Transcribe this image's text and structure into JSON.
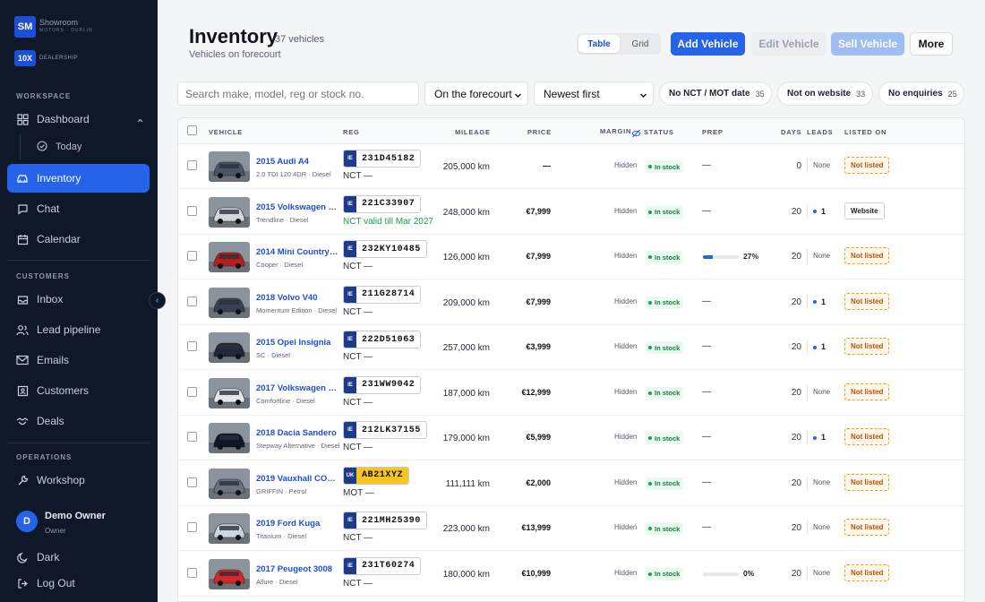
{
  "sidebar": {
    "brand_short": "SM",
    "brand_name": "Showroom",
    "brand_sub": "MOTORS · DUBLIN",
    "dealership_badge": "10X",
    "dealership_label": "DEALERSHIP",
    "workspace_title": "WORKSPACE",
    "customers_title": "CUSTOMERS",
    "operations_title": "OPERATIONS",
    "items": {
      "dashboard": "Dashboard",
      "today": "Today",
      "inventory": "Inventory",
      "chat": "Chat",
      "calendar": "Calendar",
      "inbox": "Inbox",
      "lead_pipeline": "Lead pipeline",
      "emails": "Emails",
      "customers": "Customers",
      "deals": "Deals",
      "workshop": "Workshop",
      "dark": "Dark",
      "logout": "Log Out"
    },
    "user": {
      "initial": "D",
      "name": "Demo Owner",
      "role": "Owner"
    }
  },
  "header": {
    "title": "Inventory",
    "count": "37 vehicles",
    "subtitle": "Vehicles on forecourt",
    "view_toggle": {
      "table": "Table",
      "grid": "Grid"
    },
    "add": "Add Vehicle",
    "edit": "Edit Vehicle",
    "sell": "Sell Vehicle",
    "more": "More"
  },
  "filters": {
    "search_placeholder": "Search make, model, reg or stock no.",
    "location": "On the forecourt",
    "sort": "Newest first",
    "chips": [
      {
        "label": "No NCT / MOT date",
        "count": "35"
      },
      {
        "label": "Not on website",
        "count": "33"
      },
      {
        "label": "No enquiries",
        "count": "25"
      }
    ]
  },
  "table": {
    "columns": {
      "vehicle": "VEHICLE",
      "reg": "REG",
      "mileage": "MILEAGE",
      "price": "PRICE",
      "margin": "MARGIN",
      "status": "STATUS",
      "prep": "PREP",
      "days": "DAYS",
      "leads": "LEADS",
      "listed_on": "LISTED ON"
    },
    "rows": [
      {
        "name": "2015 Audi A4",
        "sub": "2.0 TDI 120 4DR · Diesel",
        "cc": "IE",
        "reg": "231D45182",
        "nct": "NCT —",
        "mileage": "205,000 km",
        "price": "—",
        "margin": "Hidden",
        "status": "In stock",
        "prep": "—",
        "days": "0",
        "leads": "None",
        "listed": "Not listed",
        "color": "#4b5563"
      },
      {
        "name": "2015 Volkswagen Golf",
        "sub": "Trendline · Diesel",
        "cc": "IE",
        "reg": "221C33907",
        "nct": "NCT valid till Mar 2027",
        "mileage": "248,000 km",
        "price": "€7,999",
        "margin": "Hidden",
        "status": "In stock",
        "prep": "—",
        "days": "20",
        "leads": "1",
        "listed": "Website",
        "color": "#d1d5db"
      },
      {
        "name": "2014 Mini Countryman",
        "sub": "Cooper · Diesel",
        "cc": "IE",
        "reg": "232KY10485",
        "nct": "NCT —",
        "mileage": "126,000 km",
        "price": "€7,999",
        "margin": "Hidden",
        "status": "In stock",
        "prep": "27%",
        "prep_value": 27,
        "days": "20",
        "leads": "None",
        "listed": "Not listed",
        "color": "#b91c1c"
      },
      {
        "name": "2018 Volvo V40",
        "sub": "Momentum Edition · Diesel",
        "cc": "IE",
        "reg": "211G28714",
        "nct": "NCT —",
        "mileage": "209,000 km",
        "price": "€7,999",
        "margin": "Hidden",
        "status": "In stock",
        "prep": "—",
        "days": "20",
        "leads": "1",
        "listed": "Not listed",
        "color": "#374151"
      },
      {
        "name": "2015 Opel Insignia",
        "sub": "SC · Diesel",
        "cc": "IE",
        "reg": "222D51063",
        "nct": "NCT —",
        "mileage": "257,000 km",
        "price": "€3,999",
        "margin": "Hidden",
        "status": "In stock",
        "prep": "—",
        "days": "20",
        "leads": "1",
        "listed": "Not listed",
        "color": "#1f2937"
      },
      {
        "name": "2017 Volkswagen Passat",
        "sub": "Comfortline · Diesel",
        "cc": "IE",
        "reg": "231WW9042",
        "nct": "NCT —",
        "mileage": "187,000 km",
        "price": "€12,999",
        "margin": "Hidden",
        "status": "In stock",
        "prep": "—",
        "days": "20",
        "leads": "None",
        "listed": "Not listed",
        "color": "#e5e7eb"
      },
      {
        "name": "2018 Dacia Sandero",
        "sub": "Stepway Alternative · Diesel",
        "cc": "IE",
        "reg": "212LK37155",
        "nct": "NCT —",
        "mileage": "179,000 km",
        "price": "€5,999",
        "margin": "Hidden",
        "status": "In stock",
        "prep": "—",
        "days": "20",
        "leads": "1",
        "listed": "Not listed",
        "color": "#111827"
      },
      {
        "name": "2019 Vauxhall CORSA",
        "sub": "GRIFFIN · Petrol",
        "cc": "UK",
        "reg": "AB21XYZ",
        "nct": "MOT —",
        "mileage": "111,111 km",
        "price": "€2,000",
        "margin": "Hidden",
        "status": "In stock",
        "prep": "—",
        "days": "20",
        "leads": "None",
        "listed": "Not listed",
        "color": "#6b7280"
      },
      {
        "name": "2019 Ford Kuga",
        "sub": "Titanium · Diesel",
        "cc": "IE",
        "reg": "221MH25390",
        "nct": "NCT —",
        "mileage": "223,000 km",
        "price": "€13,999",
        "margin": "Hidden",
        "status": "In stock",
        "prep": "—",
        "days": "20",
        "leads": "None",
        "listed": "Not listed",
        "color": "#cbd5e1"
      },
      {
        "name": "2017 Peugeot 3008",
        "sub": "Allure · Diesel",
        "cc": "IE",
        "reg": "231T60274",
        "nct": "NCT —",
        "mileage": "180,000 km",
        "price": "€10,999",
        "margin": "Hidden",
        "status": "In stock",
        "prep": "0%",
        "prep_value": 0,
        "days": "20",
        "leads": "None",
        "listed": "Not listed",
        "color": "#dc2626"
      }
    ]
  }
}
